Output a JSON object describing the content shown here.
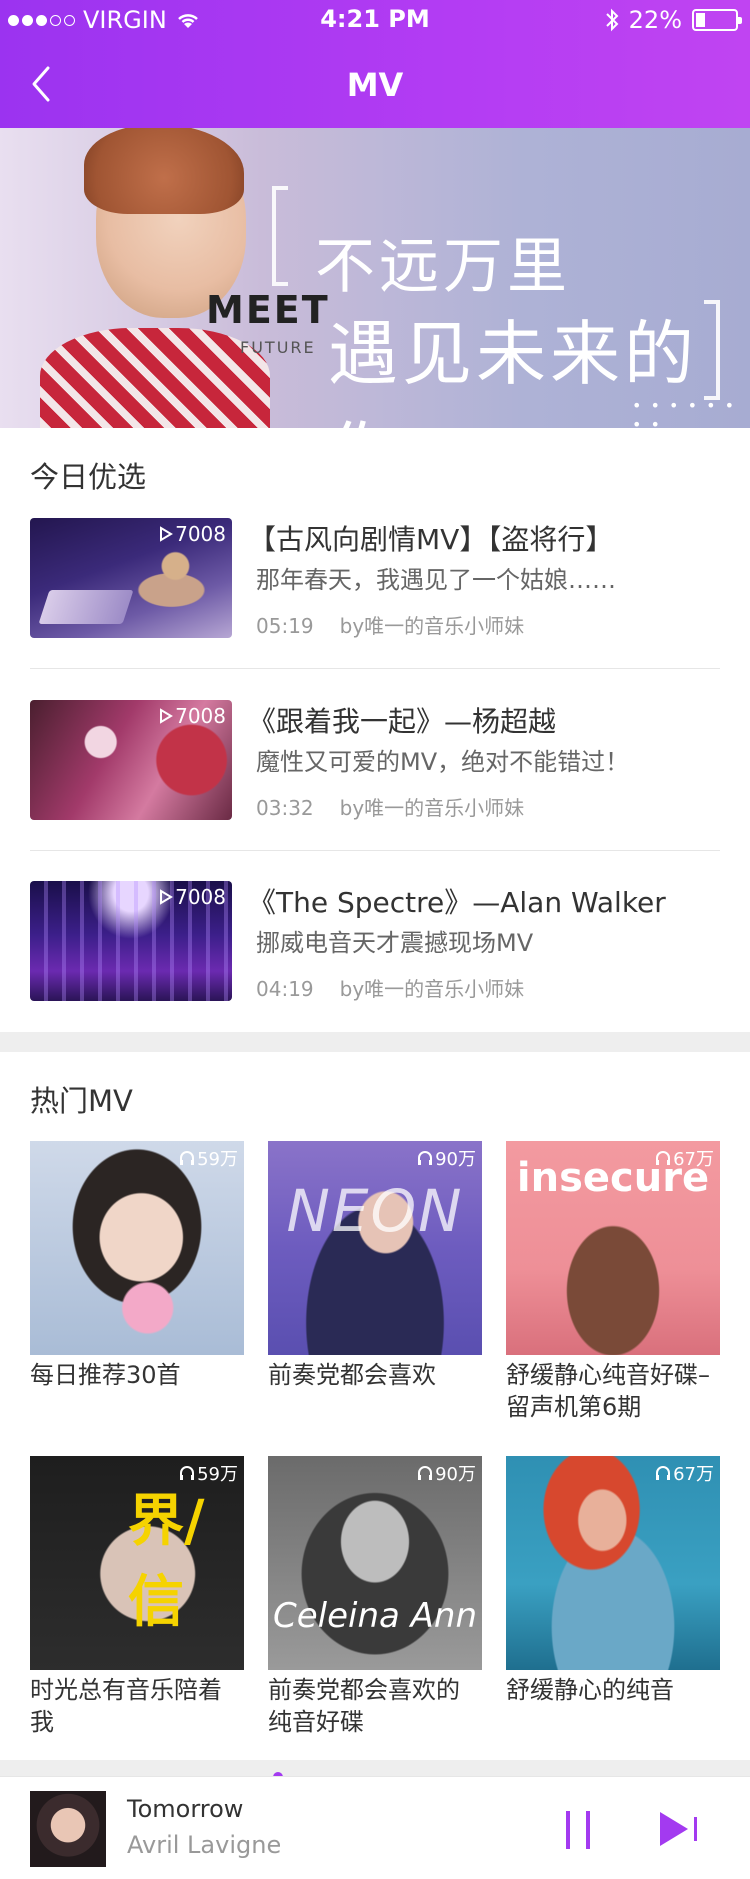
{
  "status_bar": {
    "carrier": "VIRGIN",
    "time": "4:21 PM",
    "battery": "22%"
  },
  "nav": {
    "title": "MV"
  },
  "banner": {
    "meet": "MEET",
    "future": "FUTURE",
    "line1": "不远万里",
    "line2": "遇见未来的你"
  },
  "featured": {
    "title": "今日优选",
    "items": [
      {
        "title": "【古风向剧情MV】【盗将行】",
        "desc": "那年春天，我遇见了一个姑娘……",
        "duration": "05:19",
        "author": "by唯一的音乐小师妹",
        "plays": "7008"
      },
      {
        "title": "《跟着我一起》—杨超越",
        "desc": "魔性又可爱的MV，绝对不能错过！",
        "duration": "03:32",
        "author": "by唯一的音乐小师妹",
        "plays": "7008"
      },
      {
        "title": "《The Spectre》—Alan Walker",
        "desc": "挪威电音天才震撼现场MV",
        "duration": "04:19",
        "author": "by唯一的音乐小师妹",
        "plays": "7008"
      }
    ]
  },
  "hot": {
    "title": "热门MV",
    "items": [
      {
        "caption": "每日推荐30首",
        "plays": "59万"
      },
      {
        "caption": "前奏党都会喜欢",
        "plays": "90万"
      },
      {
        "caption": "舒缓静心纯音好碟–留声机第6期",
        "plays": "67万",
        "overlay": "insecure"
      },
      {
        "caption": "时光总有音乐陪着我",
        "plays": "59万"
      },
      {
        "caption": "前奏党都会喜欢的纯音好碟",
        "plays": "90万",
        "overlay": "Celeina Ann"
      },
      {
        "caption": "舒缓静心的纯音",
        "plays": "67万"
      }
    ]
  },
  "player": {
    "song": "Tomorrow",
    "artist": "Avril Lavigne",
    "progress": 0.37
  },
  "colors": {
    "accent": "#a33af0",
    "header_start": "#9b33f0",
    "header_end": "#c044f2"
  },
  "icons": [
    "back-arrow-icon",
    "wifi-icon",
    "bluetooth-icon",
    "battery-icon",
    "play-count-icon",
    "headphones-icon",
    "pause-icon",
    "next-icon"
  ]
}
